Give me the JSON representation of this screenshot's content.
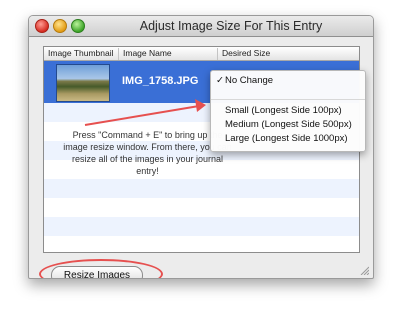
{
  "window": {
    "title": "Adjust Image Size For This Entry"
  },
  "table": {
    "columns": [
      "Image Thumbnail",
      "Image Name",
      "Desired Size"
    ],
    "rows": [
      {
        "filename": "IMG_1758.JPG",
        "selected": true
      }
    ],
    "instructions": "Press \"Command + E\" to bring up the image resize window.  From there, you can resize all of the images in your journal entry!"
  },
  "size_menu": {
    "items": [
      {
        "label": "No Change",
        "checked": true
      },
      {
        "label": "Small (Longest Side 100px)",
        "checked": false
      },
      {
        "label": "Medium (Longest Side 500px)",
        "checked": false
      },
      {
        "label": "Large (Longest Side 1000px)",
        "checked": false
      }
    ],
    "check_mark": "✓"
  },
  "buttons": {
    "resize_images": "Resize Images"
  },
  "annotation_color": "#e6504f",
  "selection_color": "#3a6fd6"
}
